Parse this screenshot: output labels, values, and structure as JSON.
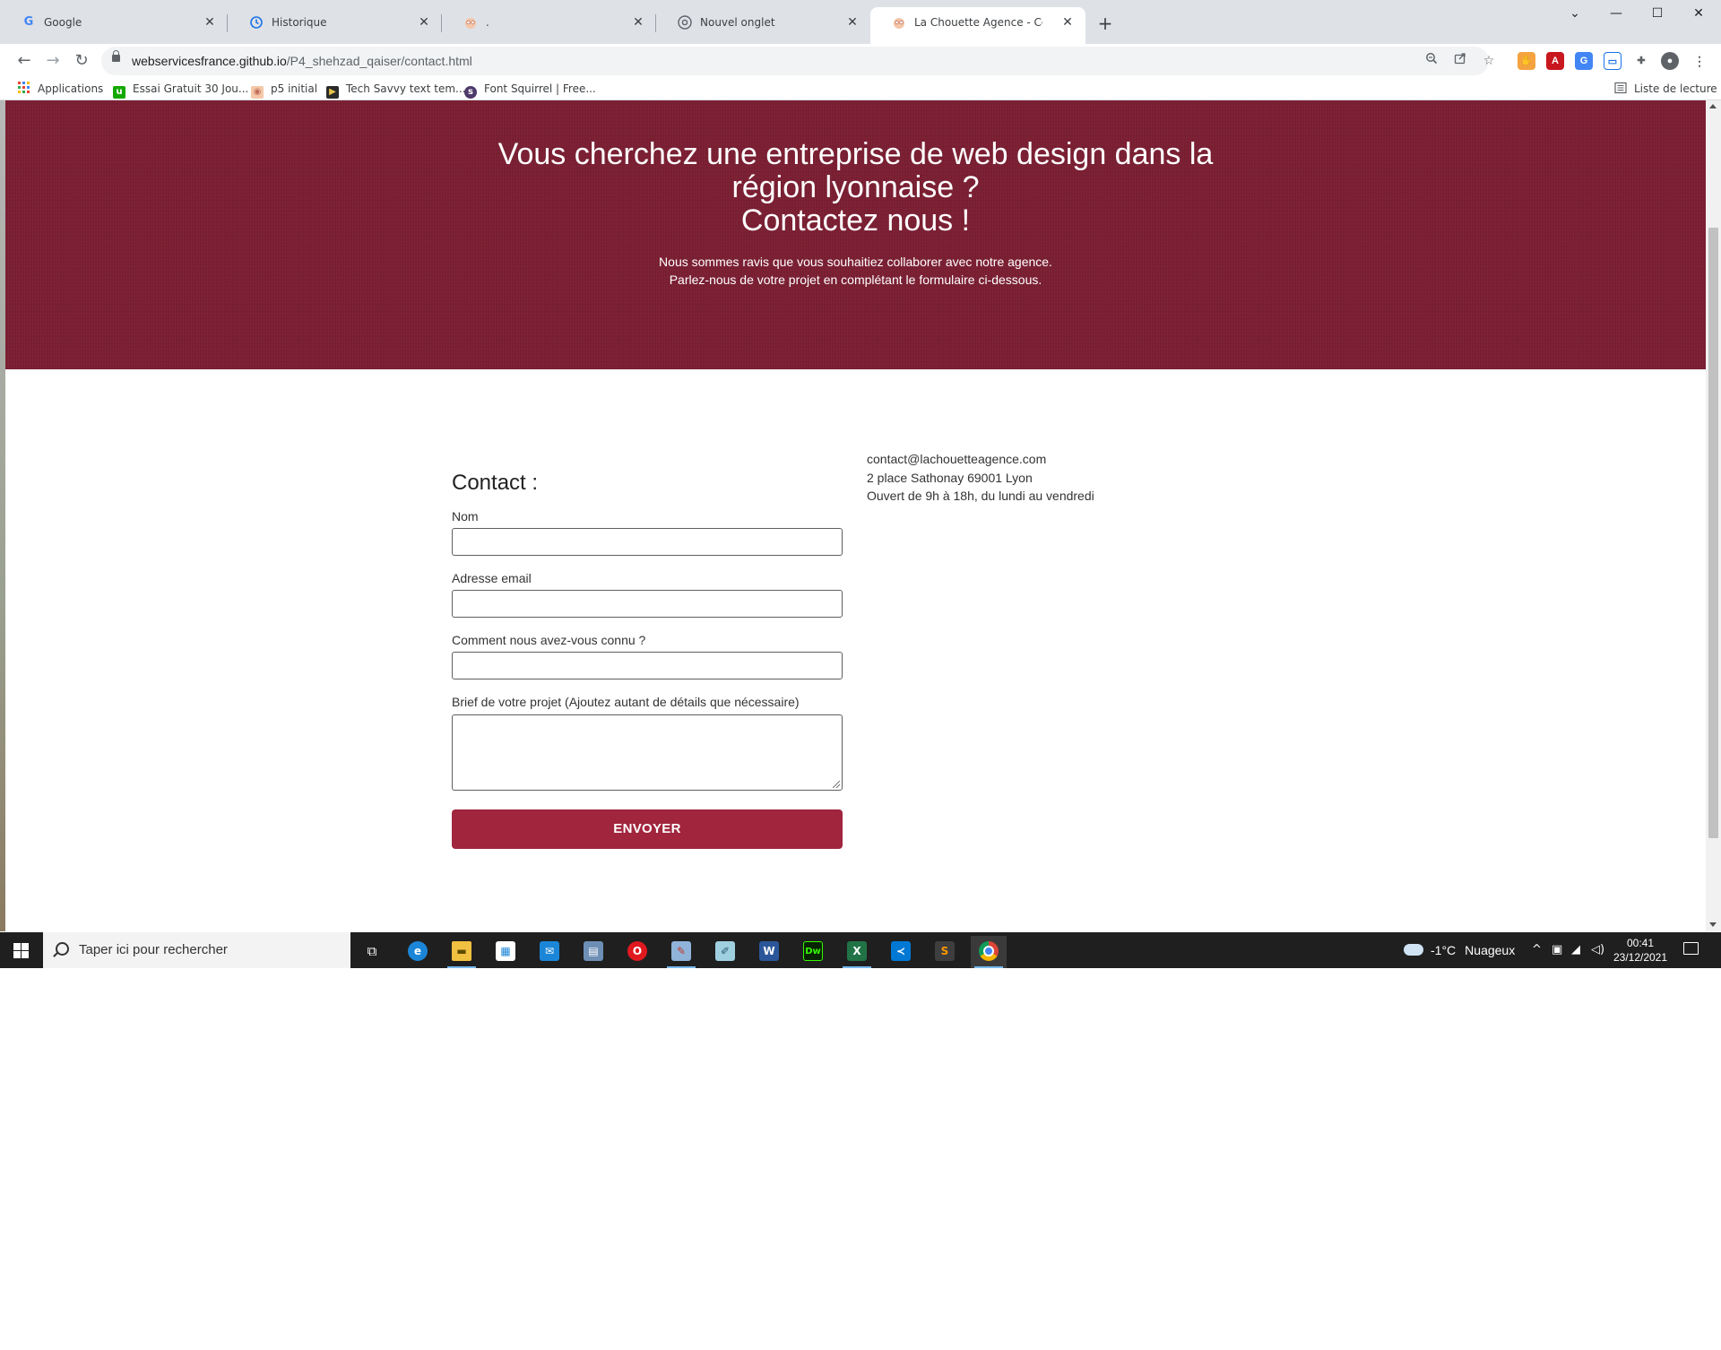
{
  "browser": {
    "tabs": [
      {
        "title": "Google",
        "icon": "google-icon",
        "active": false
      },
      {
        "title": "Historique",
        "icon": "history-icon",
        "active": false
      },
      {
        "title": ".",
        "icon": "owl-icon",
        "active": false
      },
      {
        "title": "Nouvel onglet",
        "icon": "chrome-icon",
        "active": false
      },
      {
        "title": "La Chouette Agence - Contact",
        "icon": "owl-icon",
        "active": true
      }
    ],
    "new_tab_symbol": "+",
    "url_host": "webservicesfrance.github.io",
    "url_path": "/P4_shehzad_qaiser/contact.html",
    "bookmarks": [
      {
        "label": "Applications",
        "icon": "apps-grid-icon"
      },
      {
        "label": "Essai Gratuit 30 Jou...",
        "icon": "upwork-icon",
        "color": "#14a800"
      },
      {
        "label": "p5 initial",
        "icon": "owl-icon",
        "color": "#e38b5a"
      },
      {
        "label": "Tech Savvy text tem...",
        "icon": "techsavvy-icon",
        "color": "#2b2b2b"
      },
      {
        "label": "Font Squirrel | Free...",
        "icon": "squirrel-icon",
        "color": "#4d3a6b"
      }
    ],
    "reading_list_label": "Liste de lecture"
  },
  "page": {
    "hero": {
      "title_line1": "Vous cherchez une entreprise de web design dans la",
      "title_line2": "région lyonnaise ?",
      "title_line3": "Contactez nous !",
      "subtitle_line1": "Nous sommes ravis que vous souhaitiez collaborer avec notre agence.",
      "subtitle_line2": "Parlez-nous de votre projet en complétant le formulaire ci-dessous.",
      "bg_color": "#7b1f33"
    },
    "form": {
      "title": "Contact :",
      "name_label": "Nom",
      "name_value": "",
      "email_label": "Adresse email",
      "email_value": "",
      "source_label": "Comment nous avez-vous connu ?",
      "source_value": "",
      "brief_label": "Brief de votre projet (Ajoutez autant de détails que nécessaire)",
      "brief_value": "",
      "submit_label": "ENVOYER",
      "submit_color": "#a0253d"
    },
    "info": {
      "email": "contact@lachouetteagence.com",
      "address": "2 place Sathonay 69001 Lyon",
      "hours": "Ouvert de 9h à 18h, du lundi au vendredi"
    }
  },
  "taskbar": {
    "search_placeholder": "Taper ici pour rechercher",
    "apps": [
      "task-view-icon",
      "edge-icon",
      "file-explorer-icon",
      "store-icon",
      "mail-icon",
      "calculator-icon",
      "opera-icon",
      "paint-icon",
      "notepad-icon",
      "word-icon",
      "dreamweaver-icon",
      "excel-icon",
      "vscode-icon",
      "sublime-icon",
      "chrome-icon"
    ],
    "weather_temp": "-1°C",
    "weather_desc": "Nuageux",
    "time": "00:41",
    "date": "23/12/2021"
  }
}
